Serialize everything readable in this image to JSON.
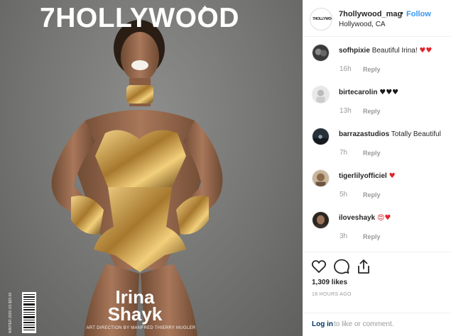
{
  "cover": {
    "magazine_title": "7HOLLYWOOD",
    "first_name": "Irina",
    "last_name": "Shayk",
    "credit": "ART DIRECTION BY MANFRED THIERRY MUGLER",
    "barcode_text": "WINTER 2020 US $20.00"
  },
  "post": {
    "username": "7hollywood_mag",
    "separator": "•",
    "follow_label": "Follow",
    "location": "Hollywood, CA",
    "avatar_text": "7HOLLYWOOD"
  },
  "comments": [
    {
      "user": "sofhpixie",
      "text": "Beautiful Irina!",
      "emoji": "♥♥",
      "emoji_class": "heart-red",
      "time": "16h",
      "reply": "Reply"
    },
    {
      "user": "birtecarolin",
      "text": "",
      "emoji": "♥♥♥",
      "emoji_class": "heart-black",
      "time": "13h",
      "reply": "Reply"
    },
    {
      "user": "barrazastudios",
      "text": "Totally Beautiful",
      "emoji": "",
      "emoji_class": "",
      "time": "7h",
      "reply": "Reply"
    },
    {
      "user": "tigerlilyofficiel",
      "text": "",
      "emoji": "♥",
      "emoji_class": "heart-red",
      "time": "5h",
      "reply": "Reply"
    },
    {
      "user": "iloveshayk",
      "text": "",
      "emoji": "😍♥",
      "emoji_class": "heart-red",
      "time": "3h",
      "reply": "Reply"
    }
  ],
  "actions": {
    "likes": "1,309 likes",
    "time_ago": "18 HOURS AGO",
    "icons": [
      "heart-icon",
      "comment-icon",
      "share-icon"
    ]
  },
  "footer": {
    "login_link": "Log in",
    "login_rest": "to like or comment."
  },
  "colors": {
    "link_blue": "#3897f0",
    "login_blue": "#003569",
    "muted_gray": "#999999",
    "heart_red": "#e1232b"
  }
}
